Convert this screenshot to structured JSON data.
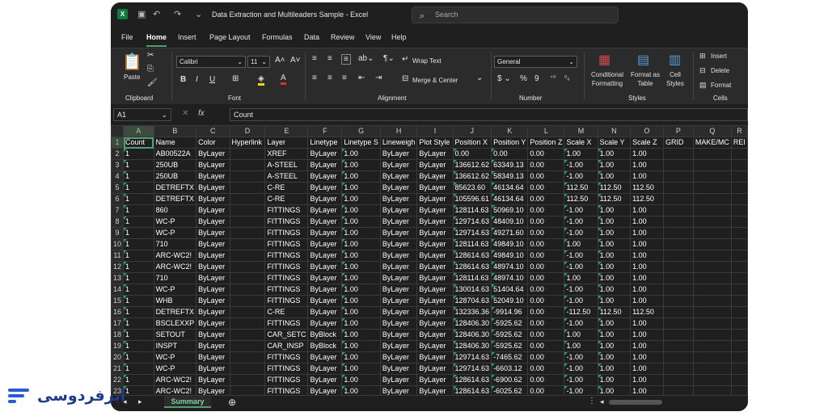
{
  "window": {
    "title": "Data Extraction and Multileaders Sample  -  Excel",
    "search_placeholder": "Search"
  },
  "menu": [
    "File",
    "Home",
    "Insert",
    "Page Layout",
    "Formulas",
    "Data",
    "Review",
    "View",
    "Help"
  ],
  "active_menu": "Home",
  "ribbon": {
    "clipboard": {
      "paste": "Paste",
      "group": "Clipboard"
    },
    "font": {
      "family": "Calibri",
      "size": "11",
      "group": "Font"
    },
    "alignment": {
      "wrap": "Wrap Text",
      "merge": "Merge & Center",
      "group": "Alignment"
    },
    "number": {
      "format": "General",
      "group": "Number"
    },
    "styles": {
      "conditional": "Conditional Formatting",
      "format_table": "Format as Table",
      "cell_styles": "Cell Styles",
      "group": "Styles"
    },
    "cells": {
      "insert": "Insert",
      "delete": "Delete",
      "format": "Format",
      "group": "Cells"
    }
  },
  "formula_bar": {
    "name_box": "A1",
    "fx": "fx",
    "content": "Count"
  },
  "columns": [
    "A",
    "B",
    "C",
    "D",
    "E",
    "F",
    "G",
    "H",
    "I",
    "J",
    "K",
    "L",
    "M",
    "N",
    "O",
    "P",
    "Q",
    "R"
  ],
  "rows": [
    [
      "Count",
      "Name",
      "Color",
      "Hyperlink",
      "Layer",
      "Linetype",
      "Linetype S",
      "Lineweigh",
      "Plot Style",
      "Position X",
      "Position Y",
      "Position Z",
      "Scale X",
      "Scale Y",
      "Scale Z",
      "GRID",
      "MAKE/MC",
      "REI"
    ],
    [
      "1",
      "AB00522A",
      "ByLayer",
      "",
      "XREF",
      "ByLayer",
      "1.00",
      "ByLayer",
      "ByLayer",
      "0.00",
      "0.00",
      "0.00",
      "1.00",
      "1.00",
      "1.00",
      "",
      "",
      ""
    ],
    [
      "1",
      "250UB",
      "ByLayer",
      "",
      "A-STEEL",
      "ByLayer",
      "1.00",
      "ByLayer",
      "ByLayer",
      "136612.62",
      "63349.13",
      "0.00",
      "-1.00",
      "1.00",
      "1.00",
      "",
      "",
      ""
    ],
    [
      "1",
      "250UB",
      "ByLayer",
      "",
      "A-STEEL",
      "ByLayer",
      "1.00",
      "ByLayer",
      "ByLayer",
      "136612.62",
      "58349.13",
      "0.00",
      "-1.00",
      "1.00",
      "1.00",
      "",
      "",
      ""
    ],
    [
      "1",
      "DETREFTX",
      "ByLayer",
      "",
      "C-RE",
      "ByLayer",
      "1.00",
      "ByLayer",
      "ByLayer",
      "85623.60",
      "46134.64",
      "0.00",
      "112.50",
      "112.50",
      "112.50",
      "",
      "",
      ""
    ],
    [
      "1",
      "DETREFTX",
      "ByLayer",
      "",
      "C-RE",
      "ByLayer",
      "1.00",
      "ByLayer",
      "ByLayer",
      "105596.61",
      "46134.64",
      "0.00",
      "112.50",
      "112.50",
      "112.50",
      "",
      "",
      ""
    ],
    [
      "1",
      "860",
      "ByLayer",
      "",
      "FITTINGS",
      "ByLayer",
      "1.00",
      "ByLayer",
      "ByLayer",
      "128114.63",
      "50969.10",
      "0.00",
      "-1.00",
      "1.00",
      "1.00",
      "",
      "",
      ""
    ],
    [
      "1",
      "WC-P",
      "ByLayer",
      "",
      "FITTINGS",
      "ByLayer",
      "1.00",
      "ByLayer",
      "ByLayer",
      "129714.63",
      "48409.10",
      "0.00",
      "-1.00",
      "1.00",
      "1.00",
      "",
      "",
      ""
    ],
    [
      "1",
      "WC-P",
      "ByLayer",
      "",
      "FITTINGS",
      "ByLayer",
      "1.00",
      "ByLayer",
      "ByLayer",
      "129714.63",
      "49271.60",
      "0.00",
      "-1.00",
      "1.00",
      "1.00",
      "",
      "",
      ""
    ],
    [
      "1",
      "710",
      "ByLayer",
      "",
      "FITTINGS",
      "ByLayer",
      "1.00",
      "ByLayer",
      "ByLayer",
      "128114.63",
      "49849.10",
      "0.00",
      "1.00",
      "1.00",
      "1.00",
      "",
      "",
      ""
    ],
    [
      "1",
      "ARC-WC2!",
      "ByLayer",
      "",
      "FITTINGS",
      "ByLayer",
      "1.00",
      "ByLayer",
      "ByLayer",
      "128614.63",
      "49849.10",
      "0.00",
      "-1.00",
      "1.00",
      "1.00",
      "",
      "",
      ""
    ],
    [
      "1",
      "ARC-WC2!",
      "ByLayer",
      "",
      "FITTINGS",
      "ByLayer",
      "1.00",
      "ByLayer",
      "ByLayer",
      "128614.63",
      "48974.10",
      "0.00",
      "-1.00",
      "1.00",
      "1.00",
      "",
      "",
      ""
    ],
    [
      "1",
      "710",
      "ByLayer",
      "",
      "FITTINGS",
      "ByLayer",
      "1.00",
      "ByLayer",
      "ByLayer",
      "128114.63",
      "48974.10",
      "0.00",
      "1.00",
      "1.00",
      "1.00",
      "",
      "",
      ""
    ],
    [
      "1",
      "WC-P",
      "ByLayer",
      "",
      "FITTINGS",
      "ByLayer",
      "1.00",
      "ByLayer",
      "ByLayer",
      "130014.63",
      "51404.64",
      "0.00",
      "-1.00",
      "1.00",
      "1.00",
      "",
      "",
      ""
    ],
    [
      "1",
      "WHB",
      "ByLayer",
      "",
      "FITTINGS",
      "ByLayer",
      "1.00",
      "ByLayer",
      "ByLayer",
      "128704.63",
      "52049.10",
      "0.00",
      "-1.00",
      "1.00",
      "1.00",
      "",
      "",
      ""
    ],
    [
      "1",
      "DETREFTX",
      "ByLayer",
      "",
      "C-RE",
      "ByLayer",
      "1.00",
      "ByLayer",
      "ByLayer",
      "132336.36",
      "-9914.96",
      "0.00",
      "-112.50",
      "112.50",
      "112.50",
      "",
      "",
      ""
    ],
    [
      "1",
      "BSCLEXXP",
      "ByLayer",
      "",
      "FITTINGS",
      "ByLayer",
      "1.00",
      "ByLayer",
      "ByLayer",
      "128406.30",
      "-5925.62",
      "0.00",
      "-1.00",
      "1.00",
      "1.00",
      "",
      "",
      ""
    ],
    [
      "1",
      "SETOUT",
      "ByLayer",
      "",
      "CAR_SETC",
      "ByBlock",
      "1.00",
      "ByLayer",
      "ByLayer",
      "128406.30",
      "-5925.62",
      "0.00",
      "1.00",
      "1.00",
      "1.00",
      "",
      "",
      ""
    ],
    [
      "1",
      "INSPT",
      "ByLayer",
      "",
      "CAR_INSP",
      "ByBlock",
      "1.00",
      "ByLayer",
      "ByLayer",
      "128406.30",
      "-5925.62",
      "0.00",
      "1.00",
      "1.00",
      "1.00",
      "",
      "",
      ""
    ],
    [
      "1",
      "WC-P",
      "ByLayer",
      "",
      "FITTINGS",
      "ByLayer",
      "1.00",
      "ByLayer",
      "ByLayer",
      "129714.63",
      "-7465.62",
      "0.00",
      "-1.00",
      "1.00",
      "1.00",
      "",
      "",
      ""
    ],
    [
      "1",
      "WC-P",
      "ByLayer",
      "",
      "FITTINGS",
      "ByLayer",
      "1.00",
      "ByLayer",
      "ByLayer",
      "129714.63",
      "-6603.12",
      "0.00",
      "-1.00",
      "1.00",
      "1.00",
      "",
      "",
      ""
    ],
    [
      "1",
      "ARC-WC2!",
      "ByLayer",
      "",
      "FITTINGS",
      "ByLayer",
      "1.00",
      "ByLayer",
      "ByLayer",
      "128614.63",
      "-6900.62",
      "0.00",
      "-1.00",
      "1.00",
      "1.00",
      "",
      "",
      ""
    ],
    [
      "1",
      "ARC-WC2!",
      "ByLayer",
      "",
      "FITTINGS",
      "ByLayer",
      "1.00",
      "ByLayer",
      "ByLayer",
      "128614.63",
      "-6025.62",
      "0.00",
      "-1.00",
      "1.00",
      "1.00",
      "",
      "",
      ""
    ]
  ],
  "sheet_tab": "Summary",
  "brand": {
    "text": "ابرفردوسی",
    "color": "#1f3d8a"
  }
}
